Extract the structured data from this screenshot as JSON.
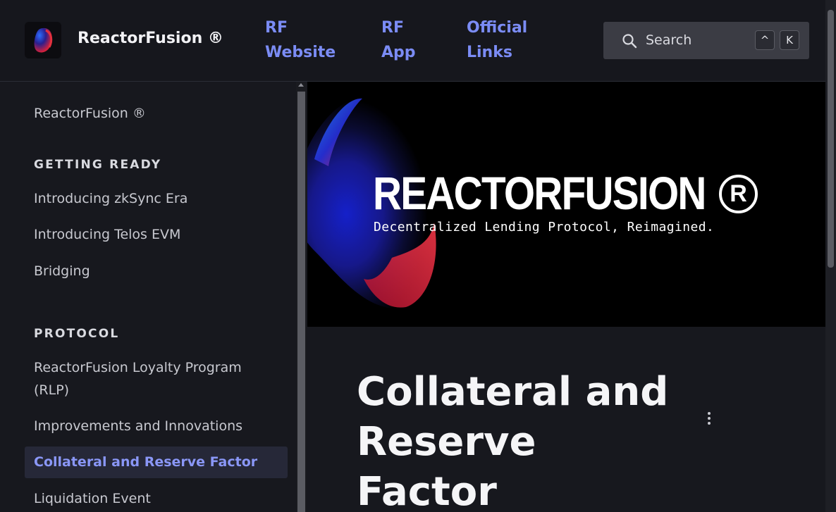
{
  "header": {
    "brand": "ReactorFusion ®",
    "nav": [
      {
        "label": "RF Website"
      },
      {
        "label": "RF App"
      },
      {
        "label": "Official Links"
      }
    ],
    "search": {
      "label": "Search",
      "shortcut_keys": [
        "^",
        "K"
      ]
    }
  },
  "sidebar": {
    "home": "ReactorFusion ®",
    "sections": [
      {
        "title": "GETTING READY",
        "items": [
          "Introducing zkSync Era",
          "Introducing Telos EVM",
          "Bridging"
        ]
      },
      {
        "title": "PROTOCOL",
        "items": [
          "ReactorFusion Loyalty Program (RLP)",
          "Improvements and Innovations",
          "Collateral and Reserve Factor",
          "Liquidation Event"
        ]
      }
    ],
    "active_item": "Collateral and Reserve Factor"
  },
  "hero": {
    "title": "REACTORFUSION",
    "reg_mark": "R",
    "subtitle": "Decentralized Lending Protocol, Reimagined."
  },
  "page": {
    "title": "Collateral and Reserve Factor"
  },
  "colors": {
    "accent": "#7b8cf5",
    "background": "#17181e",
    "active_bg": "#262838"
  }
}
